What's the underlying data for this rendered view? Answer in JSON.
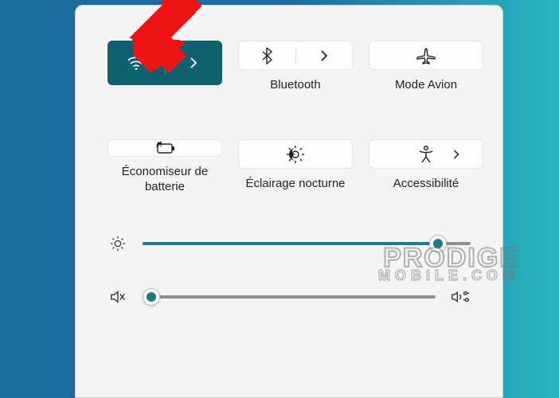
{
  "tiles": {
    "wifi": {
      "label": "",
      "active": true
    },
    "bluetooth": {
      "label": "Bluetooth",
      "active": false
    },
    "airplane": {
      "label": "Mode Avion",
      "active": false
    },
    "battery_saver": {
      "label": "Économiseur de batterie",
      "active": false
    },
    "night_light": {
      "label": "Éclairage nocturne",
      "active": false
    },
    "accessibility": {
      "label": "Accessibilité",
      "active": false
    }
  },
  "sliders": {
    "brightness": {
      "value_percent": 90
    },
    "volume": {
      "value_percent": 3,
      "muted": true
    }
  },
  "watermark": {
    "line1": "PRODIGE",
    "line2": "MOBILE.COM"
  },
  "colors": {
    "accent": "#1f7a87",
    "tile_active": "#0d6170"
  }
}
